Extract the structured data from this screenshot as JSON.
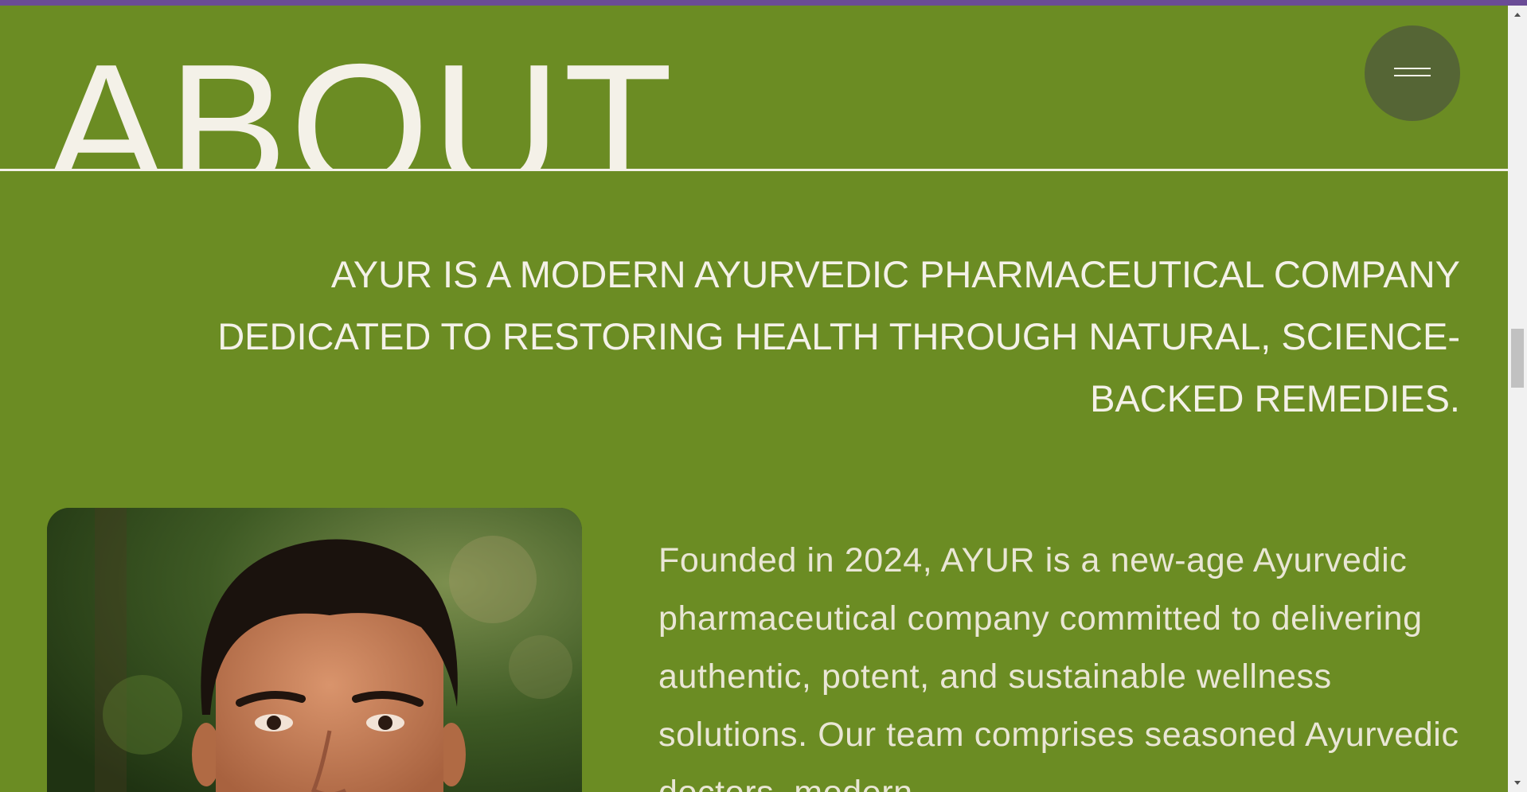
{
  "header": {
    "title": "ABOUT",
    "menu_icon": "hamburger-menu-icon"
  },
  "intro": {
    "text": "AYUR IS A MODERN AYURVEDIC PHARMACEUTICAL COMPANY DEDICATED TO RESTORING HEALTH THROUGH NATURAL, SCIENCE-BACKED REMEDIES."
  },
  "about": {
    "body": "Founded in 2024, AYUR is a new-age Ayurvedic pharmaceutical company committed to delivering authentic, potent, and sustainable wellness solutions. Our team comprises seasoned Ayurvedic doctors, modern"
  },
  "colors": {
    "background": "#6b8c23",
    "top_strip": "#6a4c96",
    "text": "#f4f1e8",
    "menu_button": "#556535"
  }
}
